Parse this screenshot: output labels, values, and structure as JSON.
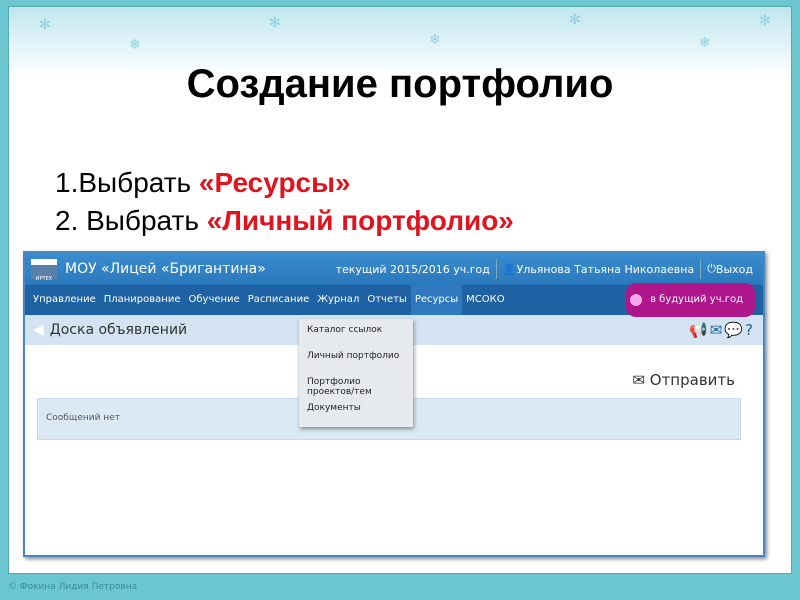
{
  "slide": {
    "title": "Создание портфолио",
    "steps": [
      {
        "prefix": "1.Выбрать ",
        "highlight": "«Ресурсы»"
      },
      {
        "prefix": "2. Выбрать ",
        "highlight": "«Личный портфолио»"
      }
    ],
    "footer": "© Фокина Лидия Петровна"
  },
  "app": {
    "logo_text": "ИРТЕХ",
    "school": "МОУ «Лицей «Бригантина»",
    "year": "текущий 2015/2016 уч.год",
    "user": "Ульянова Татьяна Николаевна",
    "logout": "Выход",
    "nav": [
      "Управление",
      "Планирование",
      "Обучение",
      "Расписание",
      "Журнал",
      "Отчеты",
      "Ресурсы",
      "МСОКО"
    ],
    "future_year": "в будущий уч.год",
    "page_title": "Доска объявлений",
    "send": "Отправить",
    "empty": "Сообщений нет",
    "dropdown": [
      "Каталог ссылок",
      "Личный портфолио",
      "Портфолио проектов/тем",
      "Документы"
    ]
  }
}
